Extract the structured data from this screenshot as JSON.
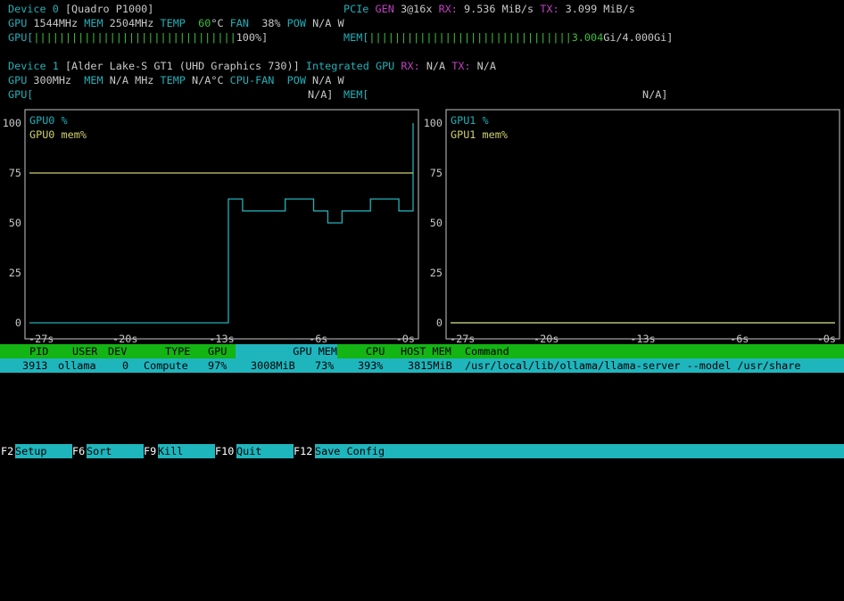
{
  "device0": {
    "label": "Device 0",
    "name": "[Quadro P1000]",
    "pcie_label": "PCIe",
    "gen_label": "GEN",
    "gen_value": "3@16x",
    "rx_label": "RX:",
    "rx_value": "9.536 MiB/s",
    "tx_label": "TX:",
    "tx_value": "3.099 MiB/s",
    "gpu_label": "GPU",
    "gpu_clock": "1544MHz",
    "mem_label": "MEM",
    "mem_clock": "2504MHz",
    "temp_label": "TEMP",
    "temp_value": "60",
    "temp_unit": "°C",
    "fan_label": "FAN",
    "fan_value": "38%",
    "pow_label": "POW",
    "pow_value": "N/A W",
    "gpu_bar_label": "GPU[",
    "gpu_bar_fill": "||||||||||||||||||||||||||||||||",
    "gpu_bar_value": "100%]",
    "mem_bar_label": "MEM[",
    "mem_bar_fill": "||||||||||||||||||||||||||||||||3.004",
    "mem_bar_value": "Gi/4.000Gi]"
  },
  "device1": {
    "label": "Device 1",
    "name": "[Alder Lake-S GT1 (UHD Graphics 730)]",
    "integrated": "Integrated GPU",
    "rx_label": "RX:",
    "rx_value": "N/A",
    "tx_label": "TX:",
    "tx_value": "N/A",
    "gpu_label": "GPU",
    "gpu_clock": "300MHz",
    "mem_label": "MEM",
    "mem_clock": "N/A MHz",
    "temp_label": "TEMP",
    "temp_value": "N/A°C",
    "fan_label": "CPU-FAN",
    "pow_label": "POW",
    "pow_value": "N/A W",
    "gpu_bar_label": "GPU[",
    "gpu_bar_value": "N/A]",
    "mem_bar_label": "MEM[",
    "mem_bar_value": "N/A]"
  },
  "chart_data": [
    {
      "type": "line",
      "y_ticks": [
        "100",
        "75",
        "50",
        "25",
        "0"
      ],
      "x_ticks": [
        "-27s",
        "-20s",
        "-13s",
        "-6s",
        "-0s"
      ],
      "ylim": [
        0,
        100
      ],
      "series": [
        {
          "name": "GPU0 %",
          "color": "#22b0b8",
          "x": [
            -27,
            -26,
            -25,
            -24,
            -23,
            -22,
            -21,
            -20,
            -19,
            -18,
            -17,
            -16,
            -15,
            -14,
            -13,
            -12,
            -11,
            -10,
            -9,
            -8,
            -7,
            -6,
            -5,
            -4,
            -3,
            -2,
            -1,
            0
          ],
          "values": [
            0,
            0,
            0,
            0,
            0,
            0,
            0,
            0,
            0,
            0,
            0,
            0,
            0,
            0,
            62,
            56,
            56,
            56,
            62,
            62,
            56,
            50,
            56,
            56,
            62,
            62,
            56,
            100
          ]
        },
        {
          "name": "GPU0 mem%",
          "color": "#d0d070",
          "x": [
            -27,
            0
          ],
          "values": [
            75,
            75
          ]
        }
      ]
    },
    {
      "type": "line",
      "y_ticks": [
        "100",
        "75",
        "50",
        "25",
        "0"
      ],
      "x_ticks": [
        "-27s",
        "-20s",
        "-13s",
        "-6s",
        "-0s"
      ],
      "ylim": [
        0,
        100
      ],
      "series": [
        {
          "name": "GPU1 %",
          "color": "#22b0b8",
          "x": [
            -27,
            0
          ],
          "values": [
            0,
            0
          ]
        },
        {
          "name": "GPU1 mem%",
          "color": "#d0d070",
          "x": [
            -27,
            0
          ],
          "values": [
            0,
            0
          ]
        }
      ]
    }
  ],
  "process_table": {
    "headers": [
      "PID",
      "USER",
      "DEV",
      "TYPE",
      "GPU",
      "GPU MEM",
      "CPU",
      "HOST MEM",
      "Command"
    ],
    "rows": [
      {
        "pid": "3913",
        "user": "ollama",
        "dev": "0",
        "type": "Compute",
        "gpu": "97%",
        "gpu_mem": "3008MiB",
        "gpu_mem_pct": "73%",
        "cpu": "393%",
        "host_mem": "3815MiB",
        "command": "/usr/local/lib/ollama/llama-server --model /usr/share"
      }
    ]
  },
  "footer": [
    {
      "key": "F2",
      "label": "Setup"
    },
    {
      "key": "F6",
      "label": "Sort"
    },
    {
      "key": "F9",
      "label": "Kill"
    },
    {
      "key": "F10",
      "label": "Quit"
    },
    {
      "key": "F12",
      "label": "Save Config"
    }
  ]
}
